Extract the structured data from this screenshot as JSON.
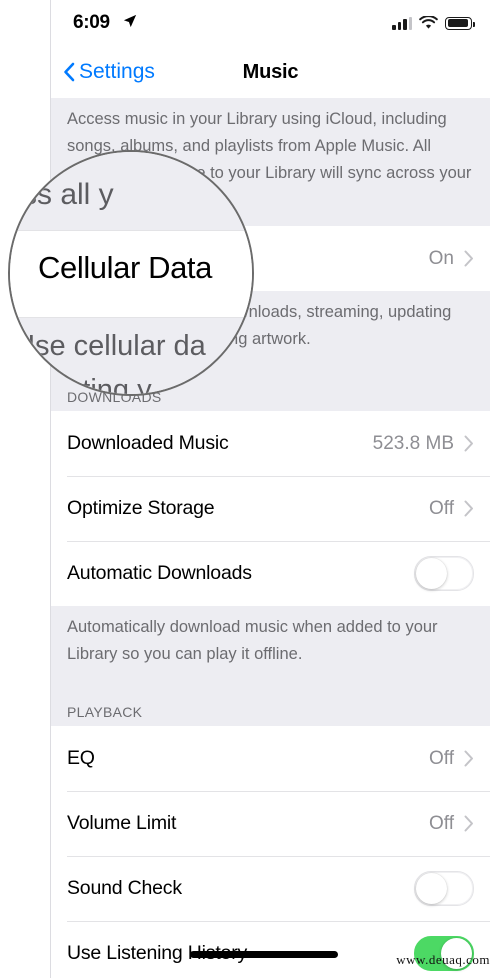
{
  "status_bar": {
    "time": "6:09",
    "location_icon": "location-arrow-icon",
    "signal_icon": "cellular-signal-icon",
    "wifi_icon": "wifi-icon",
    "battery_icon": "battery-icon"
  },
  "nav": {
    "back_label": "Settings",
    "back_icon": "chevron-left-icon",
    "title": "Music"
  },
  "sections": {
    "library_note": "Access music in your Library using iCloud, including songs, albums, and playlists from Apple Music. All changes you make to your Library will sync across your devices.",
    "cellular": {
      "label": "Cellular Data",
      "value": "On"
    },
    "cellular_note": "Use cellular data for downloads, streaming, updating your Library, and loading artwork.",
    "downloads_header": "DOWNLOADS",
    "downloads_rows": [
      {
        "label": "Downloaded Music",
        "value": "523.8 MB",
        "type": "disclosure"
      },
      {
        "label": "Optimize Storage",
        "value": "Off",
        "type": "disclosure"
      },
      {
        "label": "Automatic Downloads",
        "value": "",
        "type": "toggle",
        "toggle_state": "off"
      }
    ],
    "downloads_note": "Automatically download music when added to your Library so you can play it offline.",
    "playback_header": "PLAYBACK",
    "playback_rows": [
      {
        "label": "EQ",
        "value": "Off",
        "type": "disclosure"
      },
      {
        "label": "Volume Limit",
        "value": "Off",
        "type": "disclosure"
      },
      {
        "label": "Sound Check",
        "value": "",
        "type": "toggle",
        "toggle_state": "off"
      },
      {
        "label": "Use Listening History",
        "value": "",
        "type": "toggle",
        "toggle_state": "on"
      }
    ]
  },
  "magnifier": {
    "text_above": "ss all y",
    "main_text": "Cellular Data",
    "text_below_1": "Use cellular da",
    "text_below_2": "dating y"
  },
  "watermark": "www.deuaq.com",
  "colors": {
    "accent_blue": "#007AFF",
    "toggle_on_green": "#4CD964",
    "group_background": "#EDEDF2",
    "secondary_text": "#6C6C70"
  }
}
